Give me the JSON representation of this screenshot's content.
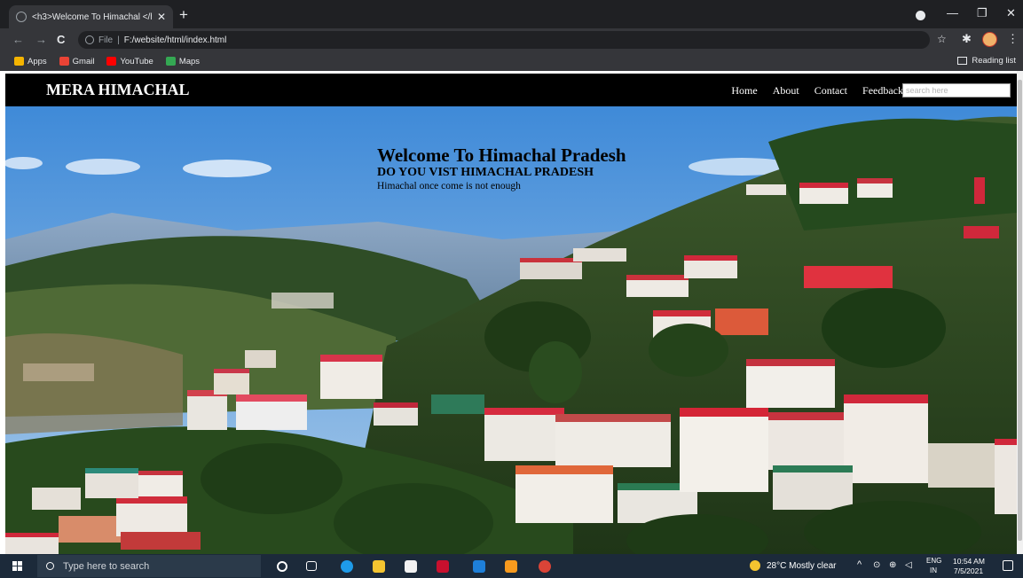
{
  "browser": {
    "tab_title": "<h3>Welcome To Himachal </h",
    "new_tab": "+",
    "tab_close": "✕",
    "window_controls": {
      "minimize": "—",
      "restore": "❐",
      "close": "✕"
    },
    "address": {
      "scheme": "File",
      "separator": "|",
      "url": "F:/website/html/index.html"
    },
    "nav_glyphs": {
      "back": "←",
      "forward": "→",
      "reload": "C"
    },
    "bookmarks": [
      {
        "label": "Apps",
        "icon": "apps-grid-icon",
        "color": "#f4b400"
      },
      {
        "label": "Gmail",
        "icon": "gmail-icon",
        "color": "#ea4335"
      },
      {
        "label": "YouTube",
        "icon": "youtube-icon",
        "color": "#ff0000"
      },
      {
        "label": "Maps",
        "icon": "maps-icon",
        "color": "#34a853"
      }
    ],
    "reading_list": "Reading list"
  },
  "site": {
    "brand": "MERA HIMACHAL",
    "nav": [
      "Home",
      "About",
      "Contact",
      "Feedback"
    ],
    "search_placeholder": "search here",
    "hero": {
      "title": "Welcome To Himachal Pradesh",
      "subtitle": "DO YOU VIST HIMACHAL PRADESH",
      "tagline": "Himachal once come is not enough"
    }
  },
  "taskbar": {
    "search_placeholder": "Type here to search",
    "weather": "28°C  Mostly clear",
    "lang": "ENG",
    "region": "IN",
    "time": "10:54 AM",
    "date": "7/5/2021",
    "pinned": [
      {
        "name": "cortana-icon",
        "color": "#ffffff"
      },
      {
        "name": "task-view-icon",
        "color": "#ffffff"
      },
      {
        "name": "edge-icon",
        "color": "#1e9be9"
      },
      {
        "name": "file-explorer-icon",
        "color": "#f4c430"
      },
      {
        "name": "store-icon",
        "color": "#f2f2f2"
      },
      {
        "name": "mcafee-icon",
        "color": "#c8102e"
      },
      {
        "name": "mail-icon",
        "color": "#1e7fd8"
      },
      {
        "name": "sublime-icon",
        "color": "#f79a1e"
      },
      {
        "name": "chrome-icon",
        "color": "#db4437"
      }
    ]
  }
}
